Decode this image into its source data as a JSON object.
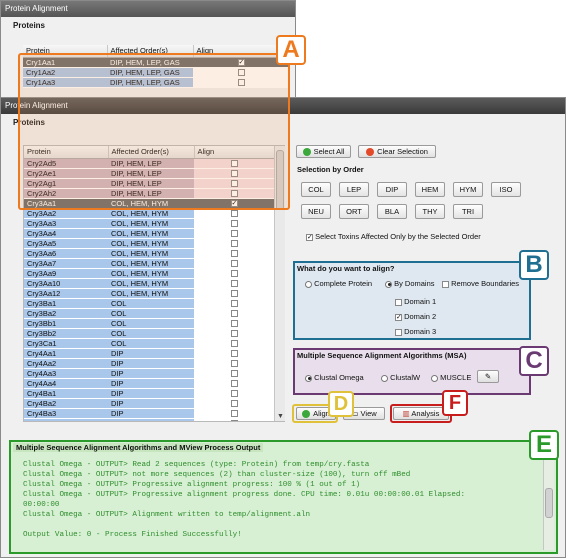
{
  "back_window": {
    "title": "Protein Alignment",
    "group_title": "Proteins",
    "columns": [
      "Protein",
      "Affected Order(s)",
      "Align"
    ],
    "rows": [
      {
        "protein": "Cry1Aa1",
        "orders": "DIP, HEM, LEP, GAS",
        "checked": true,
        "selected": true
      },
      {
        "protein": "Cry1Aa2",
        "orders": "DIP, HEM, LEP, GAS",
        "checked": false,
        "selected": false
      },
      {
        "protein": "Cry1Aa3",
        "orders": "DIP, HEM, LEP, GAS",
        "checked": false,
        "selected": false
      }
    ]
  },
  "front_window": {
    "title": "Protein Alignment",
    "group_title": "Proteins",
    "columns": [
      "Protein",
      "Affected Order(s)",
      "Align"
    ],
    "rows": [
      {
        "protein": "Cry2Ad5",
        "orders": "DIP, HEM, LEP",
        "checked": false,
        "pink": true,
        "selected": false
      },
      {
        "protein": "Cry2Ae1",
        "orders": "DIP, HEM, LEP",
        "checked": false,
        "pink": true,
        "selected": false
      },
      {
        "protein": "Cry2Ag1",
        "orders": "DIP, HEM, LEP",
        "checked": false,
        "pink": true,
        "selected": false
      },
      {
        "protein": "Cry2Ah2",
        "orders": "DIP, HEM, LEP",
        "checked": false,
        "pink": true,
        "selected": false
      },
      {
        "protein": "Cry3Aa1",
        "orders": "COL, HEM, HYM",
        "checked": true,
        "pink": false,
        "selected": true
      },
      {
        "protein": "Cry3Aa2",
        "orders": "COL, HEM, HYM",
        "checked": false,
        "pink": false,
        "selected": false
      },
      {
        "protein": "Cry3Aa3",
        "orders": "COL, HEM, HYM",
        "checked": false,
        "pink": false,
        "selected": false
      },
      {
        "protein": "Cry3Aa4",
        "orders": "COL, HEM, HYM",
        "checked": false,
        "pink": false,
        "selected": false
      },
      {
        "protein": "Cry3Aa5",
        "orders": "COL, HEM, HYM",
        "checked": false,
        "pink": false,
        "selected": false
      },
      {
        "protein": "Cry3Aa6",
        "orders": "COL, HEM, HYM",
        "checked": false,
        "pink": false,
        "selected": false
      },
      {
        "protein": "Cry3Aa7",
        "orders": "COL, HEM, HYM",
        "checked": false,
        "pink": false,
        "selected": false
      },
      {
        "protein": "Cry3Aa9",
        "orders": "COL, HEM, HYM",
        "checked": false,
        "pink": false,
        "selected": false
      },
      {
        "protein": "Cry3Aa10",
        "orders": "COL, HEM, HYM",
        "checked": false,
        "pink": false,
        "selected": false
      },
      {
        "protein": "Cry3Aa12",
        "orders": "COL, HEM, HYM",
        "checked": false,
        "pink": false,
        "selected": false
      },
      {
        "protein": "Cry3Ba1",
        "orders": "COL",
        "checked": false,
        "pink": false,
        "selected": false
      },
      {
        "protein": "Cry3Ba2",
        "orders": "COL",
        "checked": false,
        "pink": false,
        "selected": false
      },
      {
        "protein": "Cry3Bb1",
        "orders": "COL",
        "checked": false,
        "pink": false,
        "selected": false
      },
      {
        "protein": "Cry3Bb2",
        "orders": "COL",
        "checked": false,
        "pink": false,
        "selected": false
      },
      {
        "protein": "Cry3Ca1",
        "orders": "COL",
        "checked": false,
        "pink": false,
        "selected": false
      },
      {
        "protein": "Cry4Aa1",
        "orders": "DIP",
        "checked": false,
        "pink": false,
        "selected": false
      },
      {
        "protein": "Cry4Aa2",
        "orders": "DIP",
        "checked": false,
        "pink": false,
        "selected": false
      },
      {
        "protein": "Cry4Aa3",
        "orders": "DIP",
        "checked": false,
        "pink": false,
        "selected": false
      },
      {
        "protein": "Cry4Aa4",
        "orders": "DIP",
        "checked": false,
        "pink": false,
        "selected": false
      },
      {
        "protein": "Cry4Ba1",
        "orders": "DIP",
        "checked": false,
        "pink": false,
        "selected": false
      },
      {
        "protein": "Cry4Ba2",
        "orders": "DIP",
        "checked": false,
        "pink": false,
        "selected": false
      },
      {
        "protein": "Cry4Ba3",
        "orders": "DIP",
        "checked": false,
        "pink": false,
        "selected": false
      },
      {
        "protein": "Cry4Ba4",
        "orders": "DIP",
        "checked": false,
        "pink": false,
        "selected": false
      }
    ],
    "select_all_label": "Select All",
    "clear_selection_label": "Clear Selection",
    "selection_by_order_title": "Selection by Order",
    "order_buttons": [
      "COL",
      "LEP",
      "DIP",
      "HEM",
      "HYM",
      "ISO",
      "NEU",
      "ORT",
      "BLA",
      "THY",
      "TRI"
    ],
    "only_selected_order_label": "Select Toxins Affected Only by the Selected Order",
    "align_group_title": "What do you want to align?",
    "complete_protein_label": "Complete Protein",
    "by_domains_label": "By Domains",
    "remove_boundaries_label": "Remove Boundaries",
    "domains": [
      {
        "label": "Domain 1",
        "checked": false
      },
      {
        "label": "Domain 2",
        "checked": true
      },
      {
        "label": "Domain 3",
        "checked": false
      }
    ],
    "msa_title": "Multiple Sequence Alignment Algorithms (MSA)",
    "msa_options": [
      "Clustal Omega",
      "ClustalW",
      "MUSCLE"
    ],
    "align_button": "Align",
    "view_button": "View",
    "analysis_button": "Analysis",
    "output_title": "Multiple Sequence Alignment Algorithms and MView Process Output",
    "output_lines": [
      "Clustal Omega - OUTPUT> Read 2 sequences (type: Protein) from temp/cry.fasta",
      "Clustal Omega - OUTPUT> not more sequences (2) than cluster-size (100), turn off mBed",
      "Clustal Omega - OUTPUT> Progressive alignment progress: 100 % (1 out of 1)",
      "Clustal Omega - OUTPUT> Progressive alignment progress done. CPU time: 0.01u 00:00:00.01 Elapsed:",
      "00:00:00",
      "Clustal Omega - OUTPUT> Alignment written to temp/alignment.aln",
      "",
      "Output Value: 0 - Process Finished Successfully!"
    ]
  },
  "callouts": {
    "A": "A",
    "B": "B",
    "C": "C",
    "D": "D",
    "E": "E",
    "F": "F"
  },
  "colors": {
    "A": "#ee7a1f",
    "B": "#1f6f93",
    "C": "#6b3a73",
    "D": "#e0c23a",
    "E": "#2a9a2a",
    "F": "#c81d1d"
  }
}
